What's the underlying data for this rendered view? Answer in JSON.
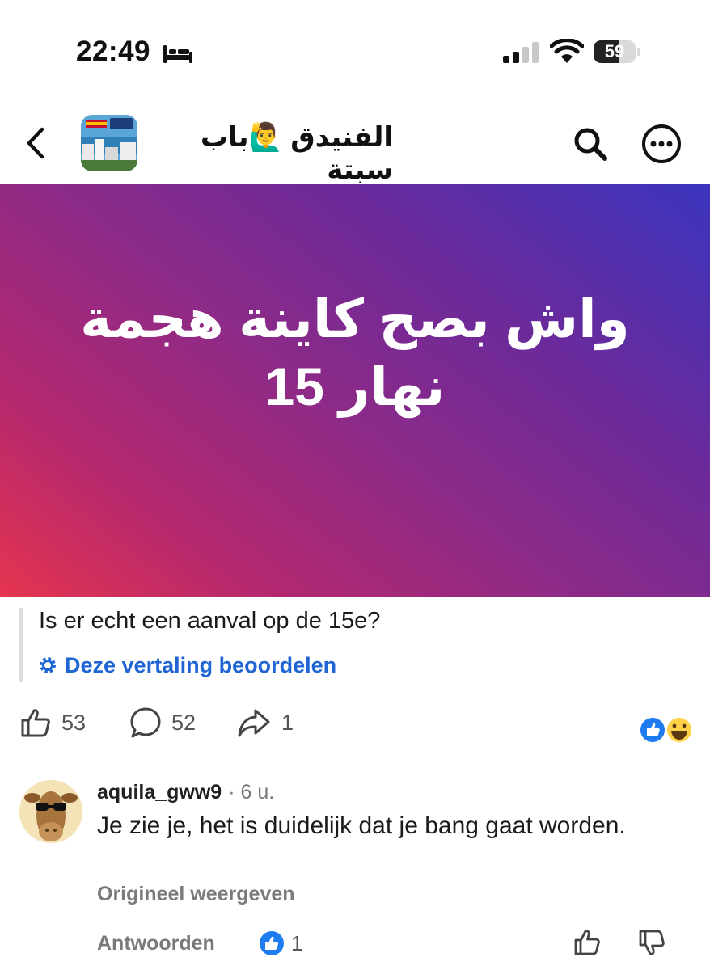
{
  "status_bar": {
    "time": "22:49",
    "battery": "59",
    "battery_level": 0.59
  },
  "header": {
    "group_name": "الفنيدق 🙋‍♂️باب سبتة"
  },
  "post": {
    "text_line1": "واش بصح كاينة هجمة",
    "text_line2": "نهار 15",
    "banner_colors": [
      "#e5344f",
      "#8f2a86",
      "#3b34be"
    ],
    "translation": "Is er echt een aanval op de 15e?",
    "rate_translation": "Deze vertaling beoordelen",
    "likes": "53",
    "comments": "52",
    "shares": "1"
  },
  "comment": {
    "author": "aquila_gww9",
    "time": "· 6 u.",
    "text": "Je zie je, het is duidelijk dat je bang gaat worden.",
    "show_original": "Origineel weergeven",
    "reply": "Antwoorden",
    "likes": "1"
  },
  "colors": {
    "accent": "#1f66d4",
    "muted": "#7a7a7a"
  }
}
